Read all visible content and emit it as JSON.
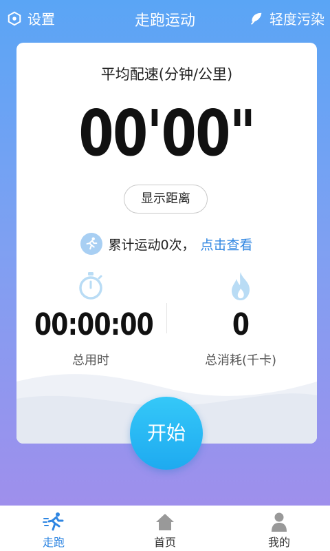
{
  "topbar": {
    "settings_label": "设置",
    "title": "走跑运动",
    "pollution_label": "轻度污染"
  },
  "card": {
    "pace_label": "平均配速(分钟/公里)",
    "pace_value": "00'00\"",
    "show_distance_label": "显示距离",
    "total_text": "累计运动0次，",
    "view_link": "点击查看",
    "time_value": "00:00:00",
    "time_label": "总用时",
    "calorie_value": "0",
    "calorie_label": "总消耗(千卡)"
  },
  "start_label": "开始",
  "bottom_nav": {
    "run": "走跑",
    "home": "首页",
    "mine": "我的"
  },
  "colors": {
    "accent": "#2f86e2",
    "start_button": "#1eaaf0"
  }
}
